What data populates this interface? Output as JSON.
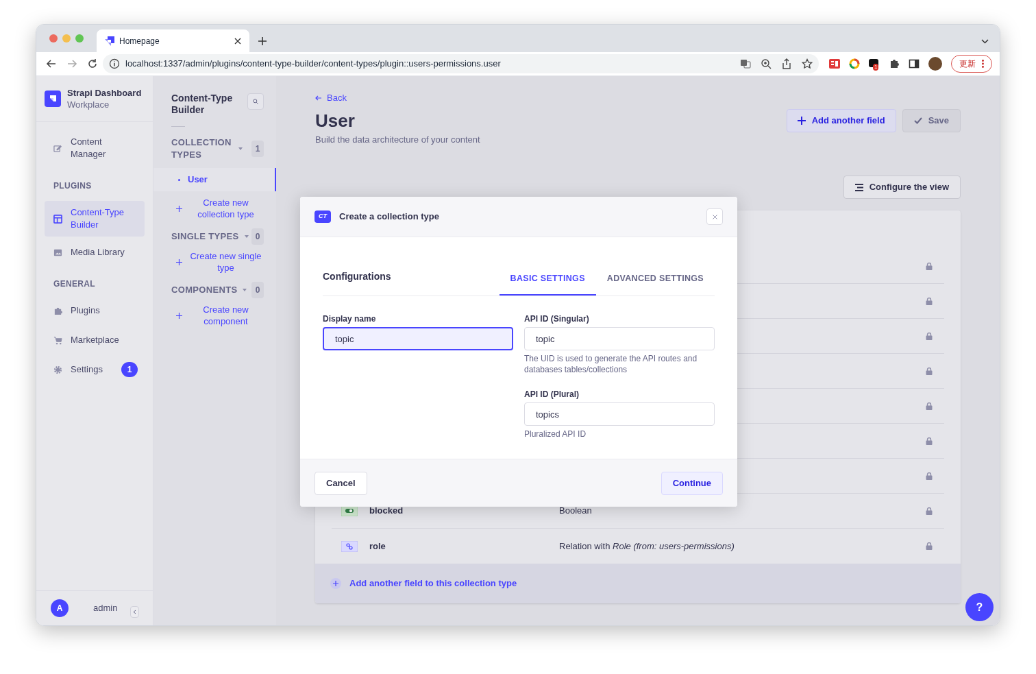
{
  "browser": {
    "tab_title": "Homepage",
    "url": "localhost:1337/admin/plugins/content-type-builder/content-types/plugin::users-permissions.user",
    "extension_badge": "1",
    "update_button": "更新"
  },
  "nav": {
    "brand_title": "Strapi Dashboard",
    "brand_subtitle": "Workplace",
    "sections": [
      {
        "items": [
          {
            "label": "Content Manager",
            "selected": false
          }
        ]
      },
      {
        "heading": "PLUGINS",
        "items": [
          {
            "label": "Content-Type Builder",
            "selected": true
          },
          {
            "label": "Media Library",
            "selected": false
          }
        ]
      },
      {
        "heading": "GENERAL",
        "items": [
          {
            "label": "Plugins",
            "selected": false
          },
          {
            "label": "Marketplace",
            "selected": false
          },
          {
            "label": "Settings",
            "selected": false,
            "badge": "1"
          }
        ]
      }
    ],
    "user": {
      "initial": "A",
      "name": "admin"
    }
  },
  "subnav": {
    "title": "Content-Type Builder",
    "groups": [
      {
        "heading": "COLLECTION TYPES",
        "count": "1",
        "items": [
          {
            "label": "User",
            "selected": true
          }
        ],
        "create_link": "Create new collection type"
      },
      {
        "heading": "SINGLE TYPES",
        "count": "0",
        "create_link": "Create new single type"
      },
      {
        "heading": "COMPONENTS",
        "count": "0",
        "create_link": "Create new component"
      }
    ]
  },
  "header": {
    "back": "Back",
    "title": "User",
    "subtitle": "Build the data architecture of your content",
    "add_field_button": "Add another field",
    "save": {
      "label": "Save",
      "disabled": true
    },
    "configure_button": "Configure the view"
  },
  "table": {
    "rows": [
      {
        "locked": true
      },
      {
        "locked": true
      },
      {
        "locked": true
      },
      {
        "locked": true
      },
      {
        "locked": true
      },
      {
        "locked": true
      },
      {
        "locked": true
      },
      {
        "kind": "boolean",
        "name": "blocked",
        "type": "Boolean",
        "locked": true
      },
      {
        "kind": "relation",
        "name": "role",
        "type": "Relation with *Role (from: users-permissions)*",
        "locked": true
      }
    ],
    "add_field": "Add another field to this collection type"
  },
  "modal": {
    "badge": "CT",
    "title": "Create a collection type",
    "section_title": "Configurations",
    "tabs": [
      {
        "label": "BASIC SETTINGS",
        "selected": true
      },
      {
        "label": "ADVANCED SETTINGS",
        "selected": false
      }
    ],
    "fields": [
      {
        "label": "Display name",
        "value": "topic",
        "focused": true
      },
      {
        "label": "API ID (Singular)",
        "value": "topic",
        "hint": "The UID is used to generate the API routes and databases tables/collections",
        "focused": false
      },
      {
        "label": "API ID (Plural)",
        "value": "topics",
        "hint": "Pluralized API ID",
        "focused": false
      }
    ],
    "cancel": "Cancel",
    "continue": "Continue"
  },
  "help_button": "?"
}
